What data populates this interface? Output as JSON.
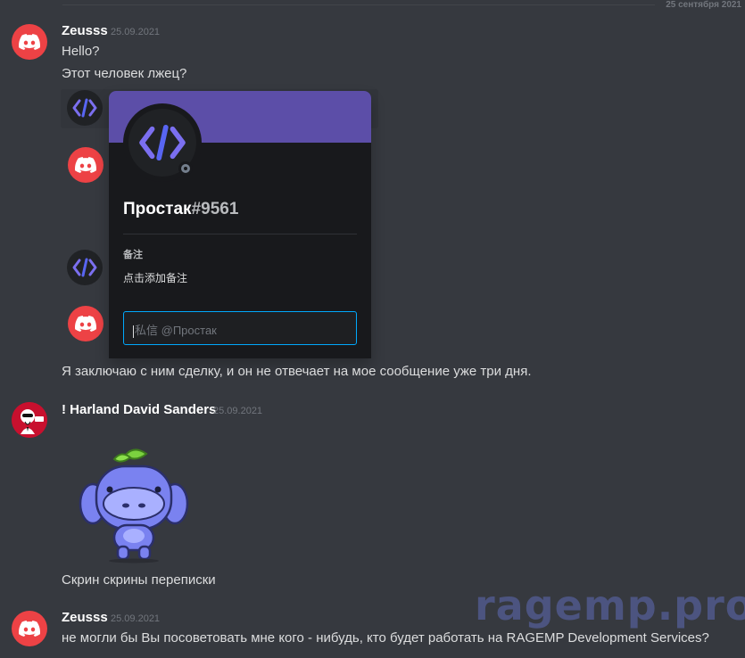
{
  "divider": {
    "date": "25 сентября 2021"
  },
  "messages": [
    {
      "username": "Zeusss",
      "timestamp": "25.09.2021",
      "lines": [
        "Hello?",
        "Этот человек лжец?"
      ]
    },
    {
      "continuation": "Я заключаю с ним сделку, и он не отвечает на мое сообщение уже три дня."
    },
    {
      "username": "! Harland David Sanders",
      "timestamp": "25.09.2021",
      "caption": "Скрин скрины переписки"
    },
    {
      "username": "Zeusss",
      "timestamp": "25.09.2021",
      "lines": [
        "не могли бы Вы посоветовать мне кого - нибудь, кто будет работать на RAGEMP Development Services?"
      ]
    }
  ],
  "popout": {
    "name": "Простак",
    "tag": "#9561",
    "note_label": "备注",
    "note_placeholder": "点击添加备注",
    "dm_placeholder_prefix": "私信",
    "dm_placeholder_handle": "@Простак",
    "banner_color": "#5c4ea8",
    "status": "offline"
  },
  "watermark": "ragemp.pro",
  "icons": {
    "discord_avatar": "discord-logo-icon",
    "code_avatar": "code-brackets-icon",
    "kfc_avatar": "kfc-colonel-icon",
    "sticker": "wumpus-sticker"
  },
  "colors": {
    "background": "#36393f",
    "discord_red": "#ed4245",
    "code_purple": "#5865f2",
    "input_focus": "#00a8fc"
  }
}
